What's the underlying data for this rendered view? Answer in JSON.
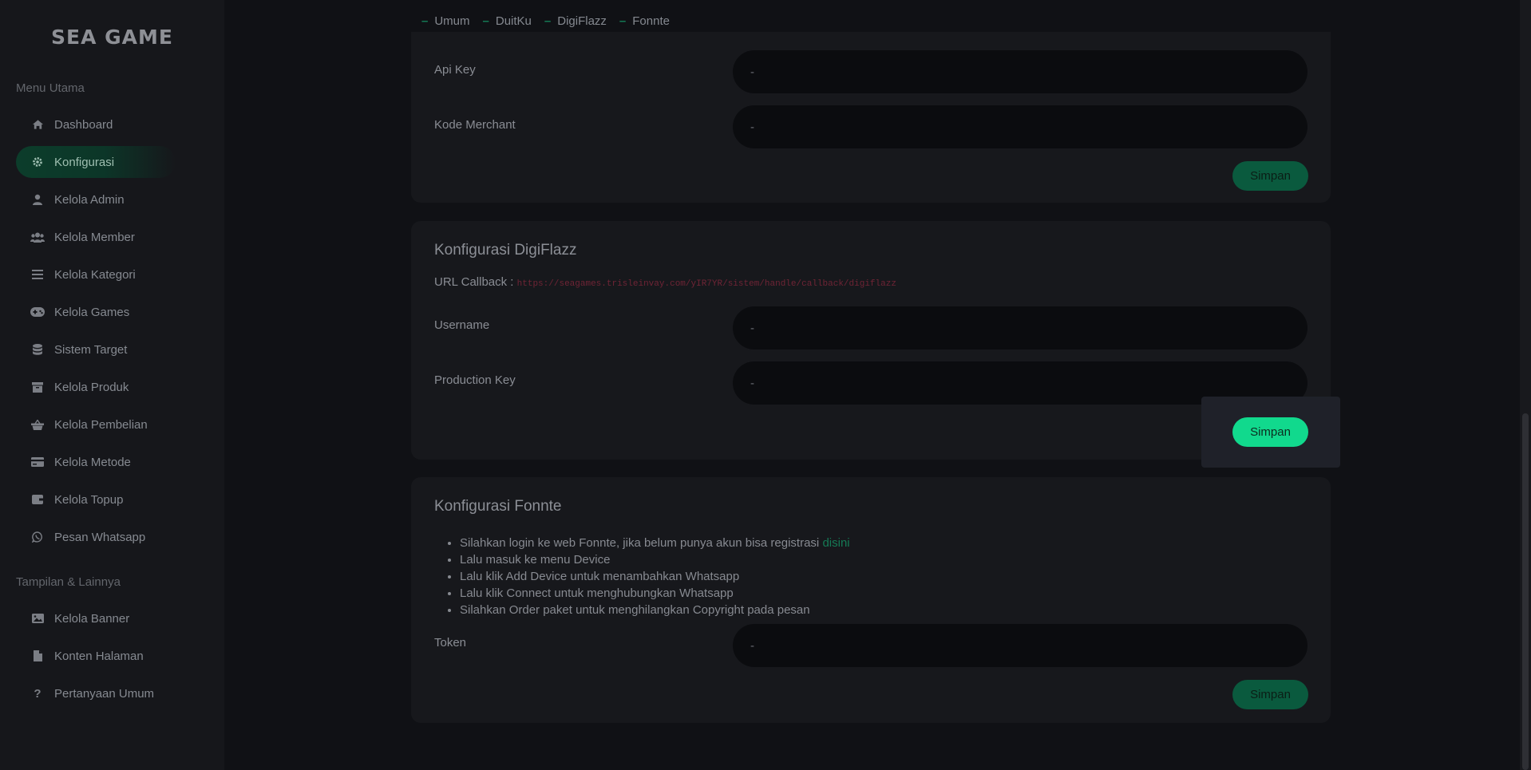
{
  "app": {
    "logo": "SEA GAME"
  },
  "sidebar": {
    "section_main": "Menu Utama",
    "items": [
      {
        "label": "Dashboard",
        "icon": "home-icon"
      },
      {
        "label": "Konfigurasi",
        "icon": "gear-icon"
      },
      {
        "label": "Kelola Admin",
        "icon": "user-icon"
      },
      {
        "label": "Kelola Member",
        "icon": "users-icon"
      },
      {
        "label": "Kelola Kategori",
        "icon": "list-icon"
      },
      {
        "label": "Kelola Games",
        "icon": "gamepad-icon"
      },
      {
        "label": "Sistem Target",
        "icon": "database-icon"
      },
      {
        "label": "Kelola Produk",
        "icon": "box-icon"
      },
      {
        "label": "Kelola Pembelian",
        "icon": "basket-icon"
      },
      {
        "label": "Kelola Metode",
        "icon": "credit-card-icon"
      },
      {
        "label": "Kelola Topup",
        "icon": "wallet-icon"
      },
      {
        "label": "Pesan Whatsapp",
        "icon": "whatsapp-icon"
      }
    ],
    "section_other": "Tampilan & Lainnya",
    "other_items": [
      {
        "label": "Kelola Banner",
        "icon": "image-icon"
      },
      {
        "label": "Konten Halaman",
        "icon": "file-icon"
      },
      {
        "label": "Pertanyaan Umum",
        "icon": "question-icon"
      }
    ],
    "active": "Konfigurasi"
  },
  "tabs": [
    "Umum",
    "DuitKu",
    "DigiFlazz",
    "Fonnte"
  ],
  "duitku": {
    "api_key_label": "Api Key",
    "api_key_value": "-",
    "merchant_label": "Kode Merchant",
    "merchant_value": "-",
    "save": "Simpan"
  },
  "digiflazz": {
    "title": "Konfigurasi DigiFlazz",
    "callback_label": "URL Callback :",
    "callback_url": "https://seagames.trisleinvay.com/yIR7YR/sistem/handle/callback/digiflazz",
    "username_label": "Username",
    "username_value": "-",
    "production_key_label": "Production Key",
    "production_key_value": "-",
    "save": "Simpan"
  },
  "fonnte": {
    "title": "Konfigurasi Fonnte",
    "steps": [
      "Silahkan login ke web Fonnte, jika belum punya akun bisa registrasi ",
      "Lalu masuk ke menu Device",
      "Lalu klik Add Device untuk menambahkan Whatsapp",
      "Lalu klik Connect untuk menghubungkan Whatsapp",
      "Silahkan Order paket untuk menghilangkan Copyright pada pesan"
    ],
    "register_link": "disini",
    "token_label": "Token",
    "token_value": "-",
    "save": "Simpan"
  }
}
